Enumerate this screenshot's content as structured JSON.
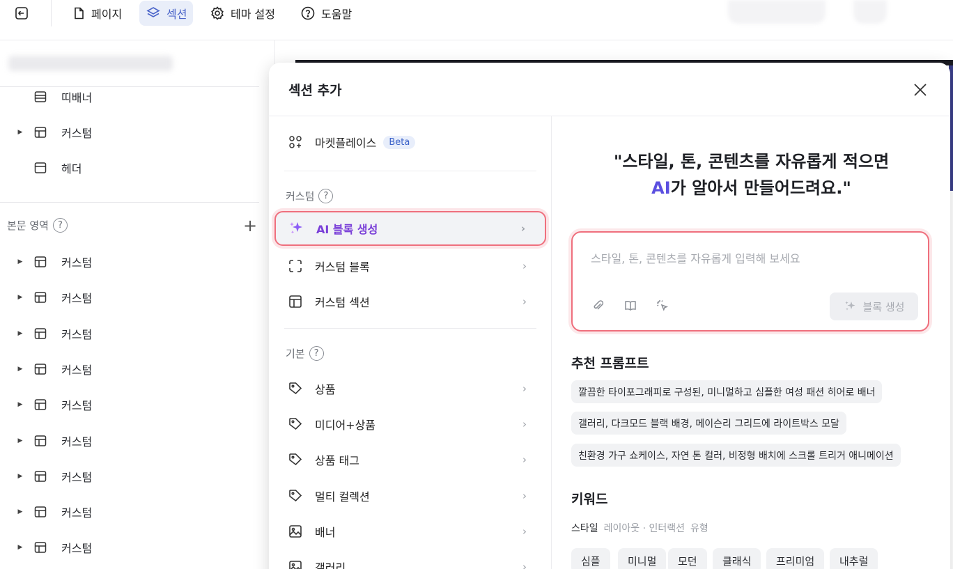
{
  "topbar": {
    "exit_icon": "exit-icon",
    "tabs": [
      {
        "label": "페이지",
        "icon": "page-icon"
      },
      {
        "label": "섹션",
        "icon": "layers-icon",
        "active": true
      },
      {
        "label": "테마 설정",
        "icon": "gear-icon"
      },
      {
        "label": "도움말",
        "icon": "help-icon"
      }
    ]
  },
  "sidebar": {
    "header_items": [
      {
        "label": "띠배너",
        "expandable": false
      },
      {
        "label": "커스텀",
        "expandable": true
      },
      {
        "label": "헤더",
        "expandable": false
      }
    ],
    "body_section_label": "본문 영역",
    "body_items": [
      {
        "label": "커스텀"
      },
      {
        "label": "커스텀"
      },
      {
        "label": "커스텀"
      },
      {
        "label": "커스텀"
      },
      {
        "label": "커스텀"
      },
      {
        "label": "커스텀"
      },
      {
        "label": "커스텀"
      },
      {
        "label": "커스텀"
      },
      {
        "label": "커스텀"
      }
    ]
  },
  "modal": {
    "title": "섹션 추가",
    "marketplace": {
      "label": "마켓플레이스",
      "badge": "Beta"
    },
    "custom_group": "커스텀",
    "custom_items": [
      {
        "label": "AI 블록 생성",
        "icon": "sparkle-icon"
      },
      {
        "label": "커스텀 블록",
        "icon": "block-icon"
      },
      {
        "label": "커스텀 섹션",
        "icon": "layout-icon"
      }
    ],
    "basic_group": "기본",
    "basic_items": [
      {
        "label": "상품",
        "icon": "tag-icon"
      },
      {
        "label": "미디어+상품",
        "icon": "tag-icon"
      },
      {
        "label": "상품 태그",
        "icon": "tag-icon"
      },
      {
        "label": "멀티 컬렉션",
        "icon": "tag-icon"
      },
      {
        "label": "배너",
        "icon": "image-icon"
      },
      {
        "label": "갤러리",
        "icon": "image-icon"
      }
    ],
    "hero_line1": "\"스타일, 톤, 콘텐츠를 자유롭게 적으면",
    "hero_ai": "AI",
    "hero_line2_rest": "가 알아서 만들어드려요.\"",
    "prompt_placeholder": "스타일, 톤, 콘텐츠를 자유롭게 입력해 보세요",
    "prompt_value": "",
    "generate_label": "블록 생성",
    "recommended_title": "추천 프롬프트",
    "recommended": [
      "깔끔한 타이포그래피로 구성된, 미니멀하고 심플한 여성 패션 히어로 배너",
      "갤러리, 다크모드 블랙 배경, 메이슨리 그리드에 라이트박스 모달",
      "친환경 가구 쇼케이스, 자연 톤 컬러, 비정형 배치에 스크롤 트리거 애니메이션"
    ],
    "keyword_title": "키워드",
    "keyword_tabs": [
      "스타일",
      "레이아웃 · 인터랙션",
      "유형"
    ],
    "keywords": [
      "심플",
      "미니멀",
      "모던",
      "클래식",
      "프리미엄",
      "내추럴"
    ]
  },
  "colors": {
    "accent": "#7a3fd8",
    "highlight_border": "#ef6f7d",
    "active_tab_bg": "#e9eef9"
  }
}
